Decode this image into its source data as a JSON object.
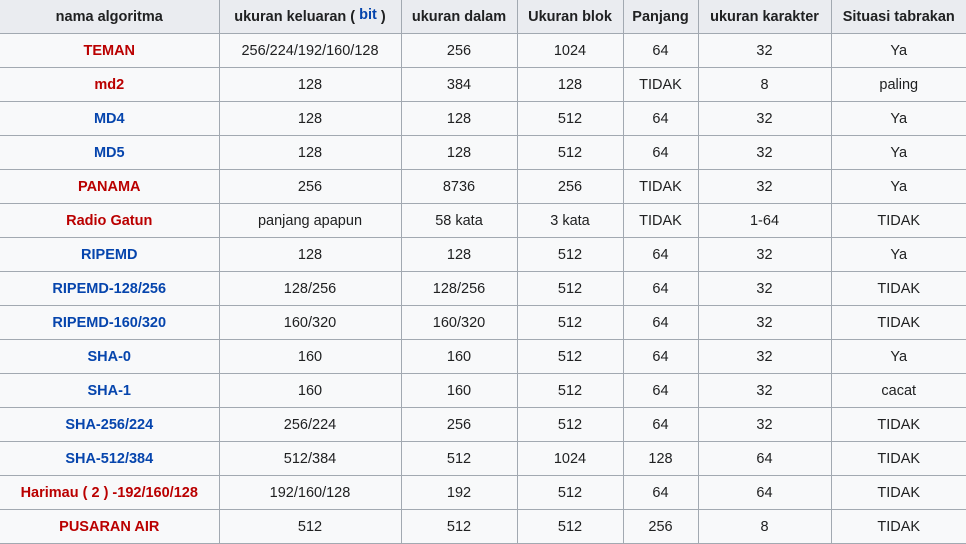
{
  "table": {
    "headers": {
      "name": "nama algoritma",
      "output_prefix": "ukuran keluaran (",
      "output_link": "bit",
      "output_suffix": ")",
      "internal": "ukuran dalam",
      "block": "Ukuran blok",
      "length": "Panjang",
      "char": "ukuran karakter",
      "collision": "Situasi tabrakan"
    },
    "link_colors": {
      "red": "#ba0000",
      "blue": "#0645ad"
    },
    "rows": [
      {
        "name": "TEMAN",
        "link": "red",
        "output": "256/224/192/160/128",
        "internal": "256",
        "block": "1024",
        "length": "64",
        "char": "32",
        "collision": "Ya"
      },
      {
        "name": "md2",
        "link": "red",
        "output": "128",
        "internal": "384",
        "block": "128",
        "length": "TIDAK",
        "char": "8",
        "collision": "paling"
      },
      {
        "name": "MD4",
        "link": "blue",
        "output": "128",
        "internal": "128",
        "block": "512",
        "length": "64",
        "char": "32",
        "collision": "Ya"
      },
      {
        "name": "MD5",
        "link": "blue",
        "output": "128",
        "internal": "128",
        "block": "512",
        "length": "64",
        "char": "32",
        "collision": "Ya"
      },
      {
        "name": "PANAMA",
        "link": "red",
        "output": "256",
        "internal": "8736",
        "block": "256",
        "length": "TIDAK",
        "char": "32",
        "collision": "Ya"
      },
      {
        "name": "Radio Gatun",
        "link": "red",
        "output": "panjang apapun",
        "internal": "58 kata",
        "block": "3 kata",
        "length": "TIDAK",
        "char": "1-64",
        "collision": "TIDAK"
      },
      {
        "name": "RIPEMD",
        "link": "blue",
        "output": "128",
        "internal": "128",
        "block": "512",
        "length": "64",
        "char": "32",
        "collision": "Ya"
      },
      {
        "name": "RIPEMD-128/256",
        "link": "blue",
        "output": "128/256",
        "internal": "128/256",
        "block": "512",
        "length": "64",
        "char": "32",
        "collision": "TIDAK"
      },
      {
        "name": "RIPEMD-160/320",
        "link": "blue",
        "output": "160/320",
        "internal": "160/320",
        "block": "512",
        "length": "64",
        "char": "32",
        "collision": "TIDAK"
      },
      {
        "name": "SHA-0",
        "link": "blue",
        "output": "160",
        "internal": "160",
        "block": "512",
        "length": "64",
        "char": "32",
        "collision": "Ya"
      },
      {
        "name": "SHA-1",
        "link": "blue",
        "output": "160",
        "internal": "160",
        "block": "512",
        "length": "64",
        "char": "32",
        "collision": "cacat"
      },
      {
        "name": "SHA-256/224",
        "link": "blue",
        "output": "256/224",
        "internal": "256",
        "block": "512",
        "length": "64",
        "char": "32",
        "collision": "TIDAK"
      },
      {
        "name": "SHA-512/384",
        "link": "blue",
        "output": "512/384",
        "internal": "512",
        "block": "1024",
        "length": "128",
        "char": "64",
        "collision": "TIDAK"
      },
      {
        "name": "Harimau ( 2 ) -192/160/128",
        "link": "red",
        "output": "192/160/128",
        "internal": "192",
        "block": "512",
        "length": "64",
        "char": "64",
        "collision": "TIDAK"
      },
      {
        "name": "PUSARAN AIR",
        "link": "red",
        "output": "512",
        "internal": "512",
        "block": "512",
        "length": "256",
        "char": "8",
        "collision": "TIDAK"
      }
    ]
  }
}
